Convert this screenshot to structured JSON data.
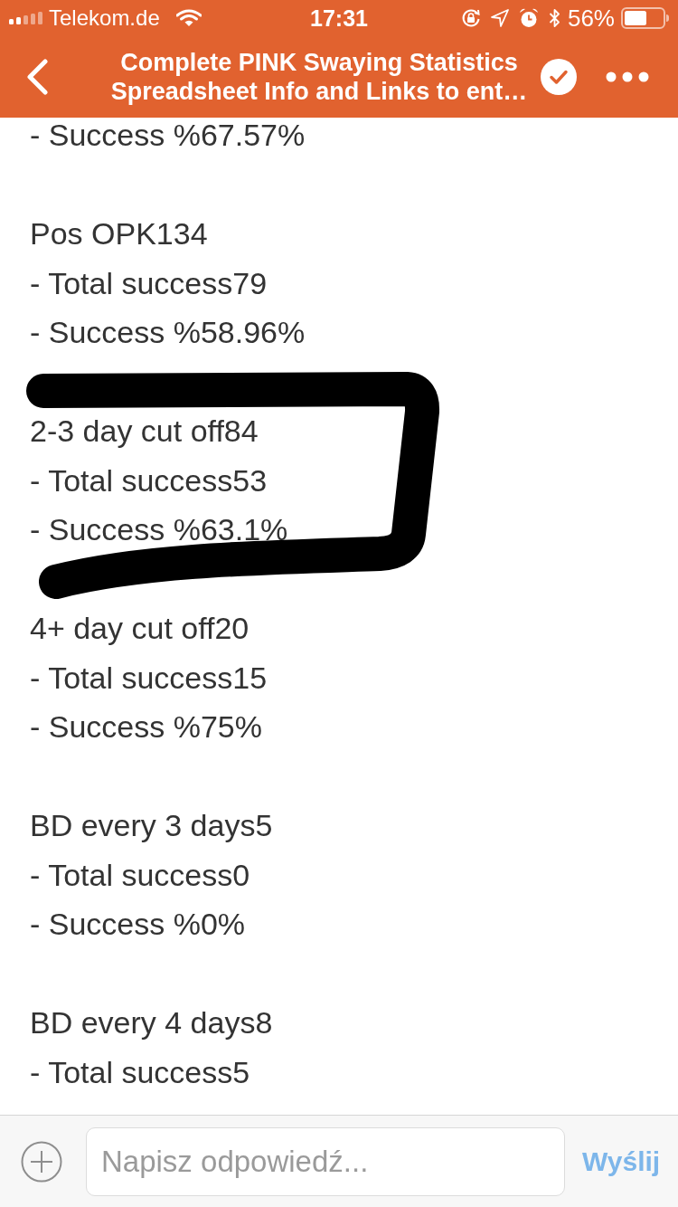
{
  "status_bar": {
    "carrier": "Telekom.de",
    "time": "17:31",
    "battery": "56%"
  },
  "nav_bar": {
    "title": "Complete PINK Swaying Statistics Spreadsheet Info and Links to ent…"
  },
  "message": {
    "groups": [
      {
        "lines": [
          "- Success %67.57%"
        ],
        "marked": false
      },
      {
        "lines": [
          "Pos OPK134",
          "- Total success79",
          "- Success %58.96%"
        ],
        "marked": false
      },
      {
        "lines": [
          "2-3 day cut off84",
          "- Total success53",
          "- Success %63.1%"
        ],
        "marked": true
      },
      {
        "lines": [
          "4+ day cut off20",
          "- Total success15",
          "- Success %75%"
        ],
        "marked": false
      },
      {
        "lines": [
          "BD every 3 days5",
          "- Total success0",
          "- Success %0%"
        ],
        "marked": false
      },
      {
        "lines": [
          "BD every 4 days8",
          "- Total success5"
        ],
        "marked": false
      }
    ]
  },
  "composer": {
    "placeholder": "Napisz odpowiedź...",
    "send_label": "Wyślij"
  }
}
